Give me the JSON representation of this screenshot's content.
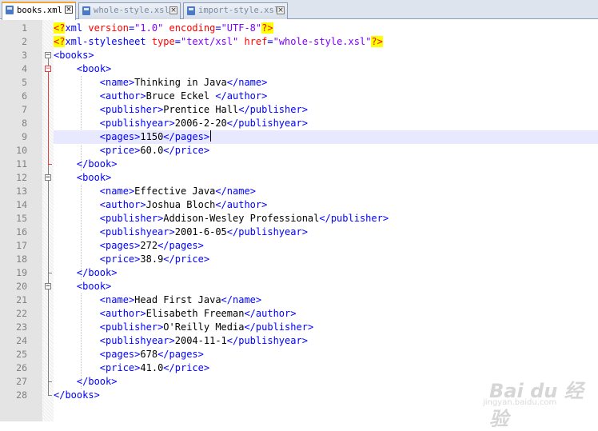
{
  "tabs": [
    {
      "label": "books.xml",
      "active": true
    },
    {
      "label": "whole-style.xsl",
      "active": false
    },
    {
      "label": "import-style.xsl",
      "active": false
    }
  ],
  "colors": {
    "tag": "#0000ff",
    "attribute": "#ff0000",
    "attribute_value": "#8000ff",
    "pi_highlight": "#ffff00",
    "current_line": "#e8e8ff",
    "active_tab_accent": "#f4a233"
  },
  "editor": {
    "current_line": 9,
    "lines": [
      {
        "n": "1",
        "tokens": [
          [
            "pi",
            "<?"
          ],
          [
            "br",
            "xml "
          ],
          [
            "attr",
            "version"
          ],
          [
            "br",
            "="
          ],
          [
            "val",
            "\"1.0\""
          ],
          [
            "br",
            " "
          ],
          [
            "attr",
            "encoding"
          ],
          [
            "br",
            "="
          ],
          [
            "val",
            "\"UTF-8\""
          ],
          [
            "pi",
            "?>"
          ]
        ]
      },
      {
        "n": "2",
        "tokens": [
          [
            "pi",
            "<?"
          ],
          [
            "br",
            "xml-stylesheet "
          ],
          [
            "attr",
            "type"
          ],
          [
            "br",
            "="
          ],
          [
            "val",
            "\"text/xsl\""
          ],
          [
            "br",
            " "
          ],
          [
            "attr",
            "href"
          ],
          [
            "br",
            "="
          ],
          [
            "val",
            "\"whole-style.xsl\""
          ],
          [
            "pi",
            "?>"
          ]
        ]
      },
      {
        "n": "3",
        "tokens": [
          [
            "br",
            "<"
          ],
          [
            "nm",
            "books"
          ],
          [
            "br",
            ">"
          ]
        ]
      },
      {
        "n": "4",
        "tokens": [
          [
            "text",
            "    "
          ],
          [
            "br",
            "<"
          ],
          [
            "nm",
            "book"
          ],
          [
            "br",
            ">"
          ]
        ]
      },
      {
        "n": "5",
        "tokens": [
          [
            "text",
            "        "
          ],
          [
            "br",
            "<"
          ],
          [
            "nm",
            "name"
          ],
          [
            "br",
            ">"
          ],
          [
            "text",
            "Thinking in Java"
          ],
          [
            "br",
            "</"
          ],
          [
            "nm",
            "name"
          ],
          [
            "br",
            ">"
          ]
        ]
      },
      {
        "n": "6",
        "tokens": [
          [
            "text",
            "        "
          ],
          [
            "br",
            "<"
          ],
          [
            "nm",
            "author"
          ],
          [
            "br",
            ">"
          ],
          [
            "text",
            "Bruce Eckel "
          ],
          [
            "br",
            "</"
          ],
          [
            "nm",
            "author"
          ],
          [
            "br",
            ">"
          ]
        ]
      },
      {
        "n": "7",
        "tokens": [
          [
            "text",
            "        "
          ],
          [
            "br",
            "<"
          ],
          [
            "nm",
            "publisher"
          ],
          [
            "br",
            ">"
          ],
          [
            "text",
            "Prentice Hall"
          ],
          [
            "br",
            "</"
          ],
          [
            "nm",
            "publisher"
          ],
          [
            "br",
            ">"
          ]
        ]
      },
      {
        "n": "8",
        "tokens": [
          [
            "text",
            "        "
          ],
          [
            "br",
            "<"
          ],
          [
            "nm",
            "publishyear"
          ],
          [
            "br",
            ">"
          ],
          [
            "text",
            "2006-2-20"
          ],
          [
            "br",
            "</"
          ],
          [
            "nm",
            "publishyear"
          ],
          [
            "br",
            ">"
          ]
        ]
      },
      {
        "n": "9",
        "tokens": [
          [
            "text",
            "        "
          ],
          [
            "br",
            "<"
          ],
          [
            "nm",
            "pages"
          ],
          [
            "br",
            ">"
          ],
          [
            "text",
            "1150"
          ],
          [
            "br",
            "</"
          ],
          [
            "nm",
            "pages"
          ],
          [
            "br",
            ">"
          ]
        ]
      },
      {
        "n": "10",
        "tokens": [
          [
            "text",
            "        "
          ],
          [
            "br",
            "<"
          ],
          [
            "nm",
            "price"
          ],
          [
            "br",
            ">"
          ],
          [
            "text",
            "60.0"
          ],
          [
            "br",
            "</"
          ],
          [
            "nm",
            "price"
          ],
          [
            "br",
            ">"
          ]
        ]
      },
      {
        "n": "11",
        "tokens": [
          [
            "text",
            "    "
          ],
          [
            "br",
            "</"
          ],
          [
            "nm",
            "book"
          ],
          [
            "br",
            ">"
          ]
        ]
      },
      {
        "n": "12",
        "tokens": [
          [
            "text",
            "    "
          ],
          [
            "br",
            "<"
          ],
          [
            "nm",
            "book"
          ],
          [
            "br",
            ">"
          ]
        ]
      },
      {
        "n": "13",
        "tokens": [
          [
            "text",
            "        "
          ],
          [
            "br",
            "<"
          ],
          [
            "nm",
            "name"
          ],
          [
            "br",
            ">"
          ],
          [
            "text",
            "Effective Java"
          ],
          [
            "br",
            "</"
          ],
          [
            "nm",
            "name"
          ],
          [
            "br",
            ">"
          ]
        ]
      },
      {
        "n": "14",
        "tokens": [
          [
            "text",
            "        "
          ],
          [
            "br",
            "<"
          ],
          [
            "nm",
            "author"
          ],
          [
            "br",
            ">"
          ],
          [
            "text",
            "Joshua Bloch"
          ],
          [
            "br",
            "</"
          ],
          [
            "nm",
            "author"
          ],
          [
            "br",
            ">"
          ]
        ]
      },
      {
        "n": "15",
        "tokens": [
          [
            "text",
            "        "
          ],
          [
            "br",
            "<"
          ],
          [
            "nm",
            "publisher"
          ],
          [
            "br",
            ">"
          ],
          [
            "text",
            "Addison-Wesley Professional"
          ],
          [
            "br",
            "</"
          ],
          [
            "nm",
            "publisher"
          ],
          [
            "br",
            ">"
          ]
        ]
      },
      {
        "n": "16",
        "tokens": [
          [
            "text",
            "        "
          ],
          [
            "br",
            "<"
          ],
          [
            "nm",
            "publishyear"
          ],
          [
            "br",
            ">"
          ],
          [
            "text",
            "2001-6-05"
          ],
          [
            "br",
            "</"
          ],
          [
            "nm",
            "publishyear"
          ],
          [
            "br",
            ">"
          ]
        ]
      },
      {
        "n": "17",
        "tokens": [
          [
            "text",
            "        "
          ],
          [
            "br",
            "<"
          ],
          [
            "nm",
            "pages"
          ],
          [
            "br",
            ">"
          ],
          [
            "text",
            "272"
          ],
          [
            "br",
            "</"
          ],
          [
            "nm",
            "pages"
          ],
          [
            "br",
            ">"
          ]
        ]
      },
      {
        "n": "18",
        "tokens": [
          [
            "text",
            "        "
          ],
          [
            "br",
            "<"
          ],
          [
            "nm",
            "price"
          ],
          [
            "br",
            ">"
          ],
          [
            "text",
            "38.9"
          ],
          [
            "br",
            "</"
          ],
          [
            "nm",
            "price"
          ],
          [
            "br",
            ">"
          ]
        ]
      },
      {
        "n": "19",
        "tokens": [
          [
            "text",
            "    "
          ],
          [
            "br",
            "</"
          ],
          [
            "nm",
            "book"
          ],
          [
            "br",
            ">"
          ]
        ]
      },
      {
        "n": "20",
        "tokens": [
          [
            "text",
            "    "
          ],
          [
            "br",
            "<"
          ],
          [
            "nm",
            "book"
          ],
          [
            "br",
            ">"
          ]
        ]
      },
      {
        "n": "21",
        "tokens": [
          [
            "text",
            "        "
          ],
          [
            "br",
            "<"
          ],
          [
            "nm",
            "name"
          ],
          [
            "br",
            ">"
          ],
          [
            "text",
            "Head First Java"
          ],
          [
            "br",
            "</"
          ],
          [
            "nm",
            "name"
          ],
          [
            "br",
            ">"
          ]
        ]
      },
      {
        "n": "22",
        "tokens": [
          [
            "text",
            "        "
          ],
          [
            "br",
            "<"
          ],
          [
            "nm",
            "author"
          ],
          [
            "br",
            ">"
          ],
          [
            "text",
            "Elisabeth Freeman"
          ],
          [
            "br",
            "</"
          ],
          [
            "nm",
            "author"
          ],
          [
            "br",
            ">"
          ]
        ]
      },
      {
        "n": "23",
        "tokens": [
          [
            "text",
            "        "
          ],
          [
            "br",
            "<"
          ],
          [
            "nm",
            "publisher"
          ],
          [
            "br",
            ">"
          ],
          [
            "text",
            "O'Reilly Media"
          ],
          [
            "br",
            "</"
          ],
          [
            "nm",
            "publisher"
          ],
          [
            "br",
            ">"
          ]
        ]
      },
      {
        "n": "24",
        "tokens": [
          [
            "text",
            "        "
          ],
          [
            "br",
            "<"
          ],
          [
            "nm",
            "publishyear"
          ],
          [
            "br",
            ">"
          ],
          [
            "text",
            "2004-11-1"
          ],
          [
            "br",
            "</"
          ],
          [
            "nm",
            "publishyear"
          ],
          [
            "br",
            ">"
          ]
        ]
      },
      {
        "n": "25",
        "tokens": [
          [
            "text",
            "        "
          ],
          [
            "br",
            "<"
          ],
          [
            "nm",
            "pages"
          ],
          [
            "br",
            ">"
          ],
          [
            "text",
            "678"
          ],
          [
            "br",
            "</"
          ],
          [
            "nm",
            "pages"
          ],
          [
            "br",
            ">"
          ]
        ]
      },
      {
        "n": "26",
        "tokens": [
          [
            "text",
            "        "
          ],
          [
            "br",
            "<"
          ],
          [
            "nm",
            "price"
          ],
          [
            "br",
            ">"
          ],
          [
            "text",
            "41.0"
          ],
          [
            "br",
            "</"
          ],
          [
            "nm",
            "price"
          ],
          [
            "br",
            ">"
          ]
        ]
      },
      {
        "n": "27",
        "tokens": [
          [
            "text",
            "    "
          ],
          [
            "br",
            "</"
          ],
          [
            "nm",
            "book"
          ],
          [
            "br",
            ">"
          ]
        ]
      },
      {
        "n": "28",
        "tokens": [
          [
            "br",
            "</"
          ],
          [
            "nm",
            "books"
          ],
          [
            "br",
            ">"
          ]
        ]
      }
    ]
  },
  "watermark": {
    "logo_text": "Bai du 经验",
    "url_text": "jingyan.baidu.com"
  }
}
